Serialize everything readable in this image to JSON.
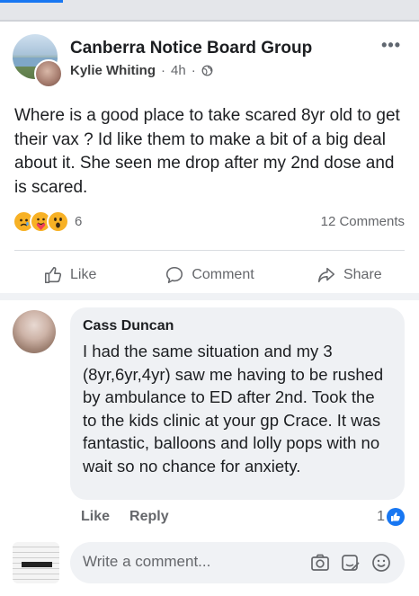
{
  "post": {
    "group_name": "Canberra Notice Board Group",
    "author": "Kylie Whiting",
    "time": "4h",
    "separator": "·",
    "text": "Where is a good place to take scared 8yr old to get their vax ? Id like them to make a bit of a big deal about it. She seen me drop after my 2nd dose and is scared.",
    "reaction_count": "6",
    "comments_count": "12 Comments",
    "actions": {
      "like": "Like",
      "comment": "Comment",
      "share": "Share"
    }
  },
  "comment": {
    "author": "Cass Duncan",
    "text": "I had the same situation and my 3 (8yr,6yr,4yr) saw me having to be rushed by ambulance to ED after 2nd. Took the to the kids clinic at your gp Crace. It was fantastic, balloons and lolly pops with no wait so no chance for anxiety.",
    "like_label": "Like",
    "reply_label": "Reply",
    "like_count": "1"
  },
  "composer": {
    "placeholder": "Write a comment..."
  },
  "colors": {
    "accent": "#1877f2",
    "muted": "#65676b",
    "bubble": "#eff1f4"
  },
  "icons": [
    "more-icon",
    "globe-icon",
    "sad-reaction-icon",
    "care-reaction-icon",
    "wow-reaction-icon",
    "like-icon",
    "comment-icon",
    "share-icon",
    "camera-icon",
    "gif-icon",
    "emoji-icon"
  ]
}
